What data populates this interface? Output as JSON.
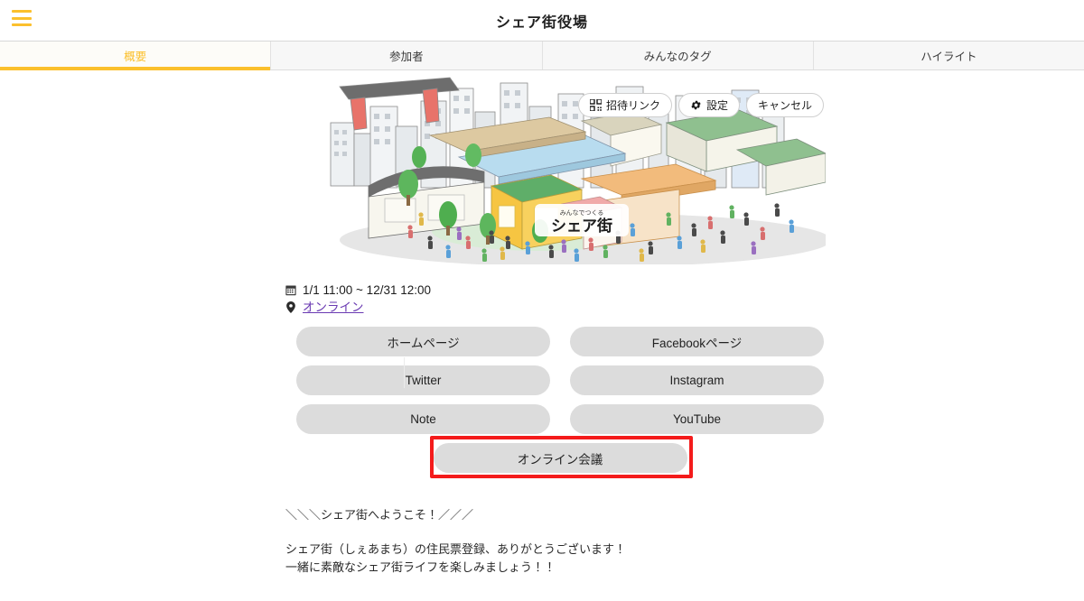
{
  "header": {
    "title": "シェア街役場",
    "menu_icon": "hamburger-icon"
  },
  "tabs": [
    {
      "label": "概要",
      "active": true
    },
    {
      "label": "参加者",
      "active": false
    },
    {
      "label": "みんなのタグ",
      "active": false
    },
    {
      "label": "ハイライト",
      "active": false
    }
  ],
  "hero": {
    "alt_text": "シェア街",
    "logo_text": "シェア街",
    "logo_ruby": "みんなでつくる",
    "actions": [
      {
        "label": "招待リンク",
        "icon": "qr-code-icon"
      },
      {
        "label": "設定",
        "icon": "gear-icon"
      },
      {
        "label": "キャンセル",
        "icon": "none"
      }
    ]
  },
  "meta": {
    "date_icon": "calendar-icon",
    "date_text": "1/1 11:00 ~ 12/31 12:00",
    "location_icon": "map-pin-icon",
    "location_text": "オンライン"
  },
  "links": [
    "ホームページ",
    "Facebookページ",
    "Twitter",
    "Instagram",
    "Note",
    "YouTube"
  ],
  "primary_action": {
    "label": "オンライン会議",
    "highlighted": true,
    "highlight_color": "#f41b1b"
  },
  "description": {
    "line1": "＼＼＼シェア街へようこそ！／／／",
    "line2": "シェア街（しぇあまち）の住民票登録、ありがとうございます！",
    "line3": "一緒に素敵なシェア街ライフを楽しみましょう！！"
  },
  "colors": {
    "accent": "#fbc02d",
    "button_bg": "#dcdcdc",
    "link": "#6a3ab2",
    "highlight": "#f41b1b"
  }
}
